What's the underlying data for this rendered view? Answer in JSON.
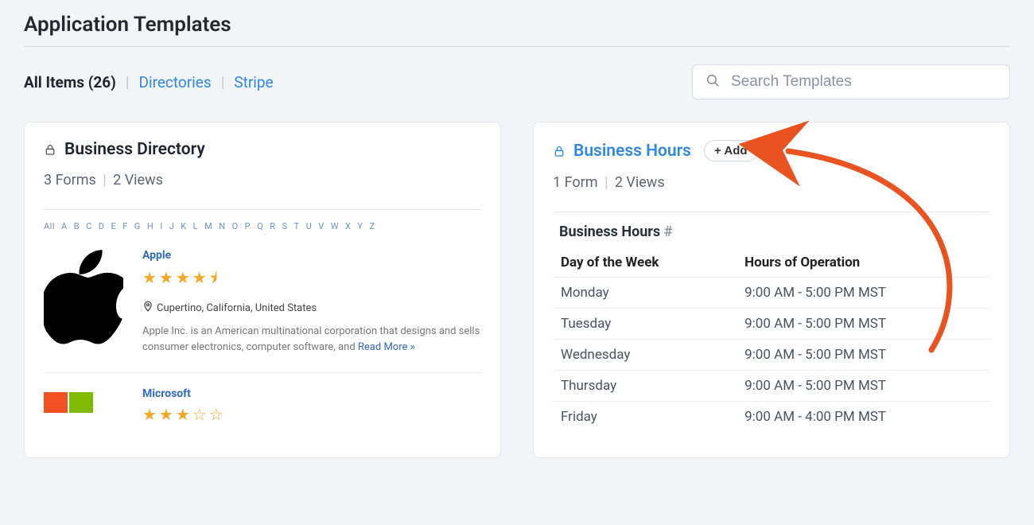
{
  "page": {
    "title": "Application Templates"
  },
  "filters": {
    "all_label": "All Items (26)",
    "directories": "Directories",
    "stripe": "Stripe"
  },
  "search": {
    "placeholder": "Search Templates"
  },
  "alphabet": [
    "All",
    "A",
    "B",
    "C",
    "D",
    "E",
    "F",
    "G",
    "H",
    "I",
    "J",
    "K",
    "L",
    "M",
    "N",
    "O",
    "P",
    "Q",
    "R",
    "S",
    "T",
    "U",
    "V",
    "W",
    "X",
    "Y",
    "Z"
  ],
  "cards": {
    "directory": {
      "title": "Business Directory",
      "sub_forms": "3 Forms",
      "sub_views": "2 Views",
      "entries": [
        {
          "name": "Apple",
          "stars": "★★★★⯨",
          "location": "Cupertino, California, United States",
          "desc": "Apple Inc. is an American multinational corporation that designs and sells consumer electronics, computer software, and ",
          "read_more": "Read More »"
        },
        {
          "name": "Microsoft",
          "stars_full": "★★★",
          "stars_empty": "☆☆"
        }
      ]
    },
    "hours": {
      "title": "Business Hours",
      "add_label": "+ Add",
      "sub_forms": "1 Form",
      "sub_views": "2 Views",
      "inner_title": "Business Hours",
      "hash": "#",
      "columns": {
        "day": "Day of the Week",
        "hours": "Hours of Operation"
      },
      "rows": [
        {
          "day": "Monday",
          "hours": "9:00 AM - 5:00 PM MST"
        },
        {
          "day": "Tuesday",
          "hours": "9:00 AM - 5:00 PM MST"
        },
        {
          "day": "Wednesday",
          "hours": "9:00 AM - 5:00 PM MST"
        },
        {
          "day": "Thursday",
          "hours": "9:00 AM - 5:00 PM MST"
        },
        {
          "day": "Friday",
          "hours": "9:00 AM - 4:00 PM MST"
        }
      ]
    }
  }
}
